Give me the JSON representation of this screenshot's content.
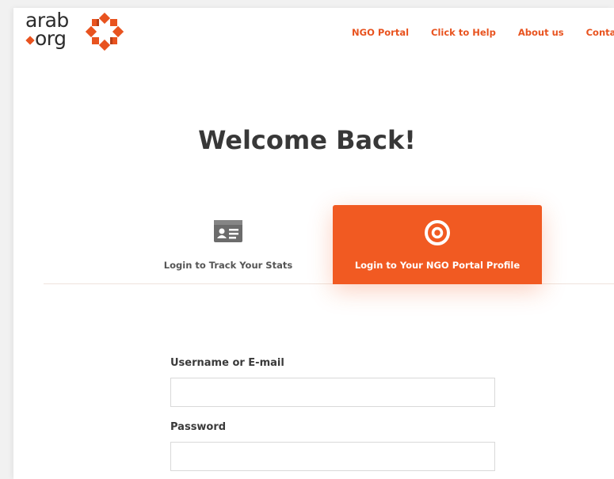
{
  "header": {
    "logo": {
      "line1": "arab",
      "line2": "org"
    },
    "nav": [
      {
        "label": "NGO Portal"
      },
      {
        "label": "Click to Help"
      },
      {
        "label": "About us"
      },
      {
        "label": "Contact us"
      }
    ]
  },
  "main": {
    "title": "Welcome Back!",
    "tabs": [
      {
        "label": "Login to Track Your Stats",
        "icon": "id-card-icon",
        "active": false
      },
      {
        "label": "Login to Your NGO Portal Profile",
        "icon": "target-icon",
        "active": true
      }
    ],
    "form": {
      "username": {
        "label": "Username or E-mail",
        "value": "",
        "placeholder": ""
      },
      "password": {
        "label": "Password",
        "value": "",
        "placeholder": ""
      }
    }
  },
  "colors": {
    "accent": "#f15a22",
    "nav_text": "#e8531f",
    "title_text": "#383838",
    "logo_dark": "#2c2c2c",
    "logo_accent": "#e8531f"
  }
}
